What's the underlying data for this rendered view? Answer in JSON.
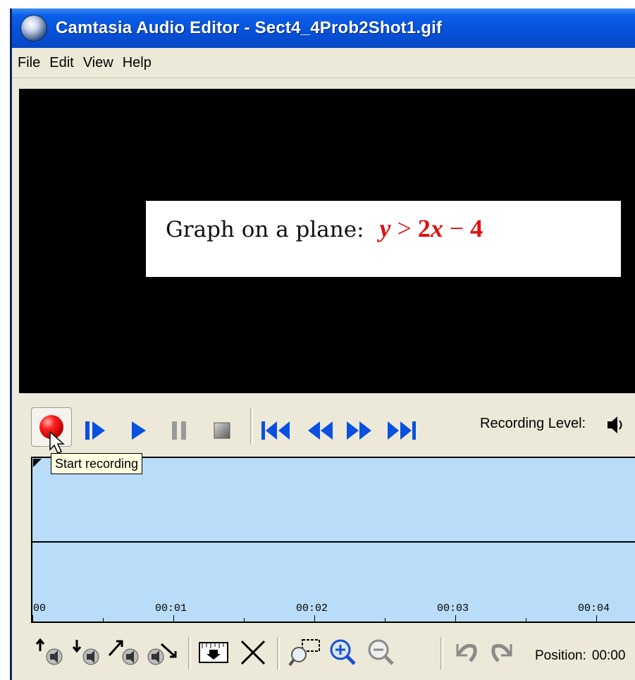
{
  "window": {
    "title": "Camtasia Audio Editor - Sect4_4Prob2Shot1.gif"
  },
  "menu": [
    "File",
    "Edit",
    "View",
    "Help"
  ],
  "preview": {
    "slide_text": "Graph on a plane:",
    "slide_equation": "y > 2x − 4",
    "equation_color": "#e01010"
  },
  "controls": {
    "record_icon": "record-icon",
    "tooltip": "Start recording",
    "recording_level_label": "Recording Level:"
  },
  "timeline": {
    "ticks": [
      "00",
      "00:01",
      "00:02",
      "00:03",
      "00:04"
    ]
  },
  "bottom_toolbar": {
    "position_label": "Position:",
    "position_value": "00:00"
  },
  "colors": {
    "titlebar": "#0750d8",
    "timeline_bg": "#b9dcf8",
    "playback_blue": "#0a50e0"
  }
}
